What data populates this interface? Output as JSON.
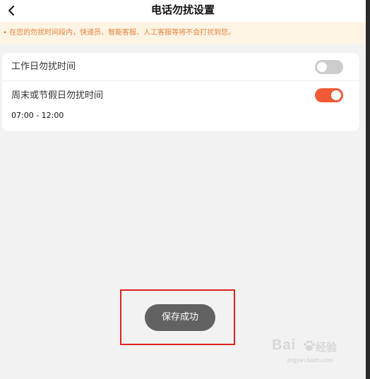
{
  "header": {
    "title": "电话勿扰设置",
    "back_icon": "chevron-left-icon"
  },
  "notice": {
    "text": "• 在您的勿扰时间段内，快递员、智能客服、人工客服等将不会打扰到您。"
  },
  "settings": {
    "weekday": {
      "label": "工作日勿扰时间",
      "enabled": false
    },
    "weekend": {
      "label": "周末或节假日勿扰时间",
      "enabled": true,
      "time_range": "07:00 - 12:00"
    }
  },
  "toast": {
    "text": "保存成功"
  },
  "watermark": {
    "brand": "Bai",
    "brand_suffix": "经验",
    "url": "jingyan.baidu.com"
  },
  "colors": {
    "accent": "#f05a35",
    "toggle_off": "#cccccc",
    "notice_text": "#e5823d",
    "notice_bg": "#fdf4e3",
    "highlight": "#e02020",
    "toast_bg": "#626262"
  }
}
